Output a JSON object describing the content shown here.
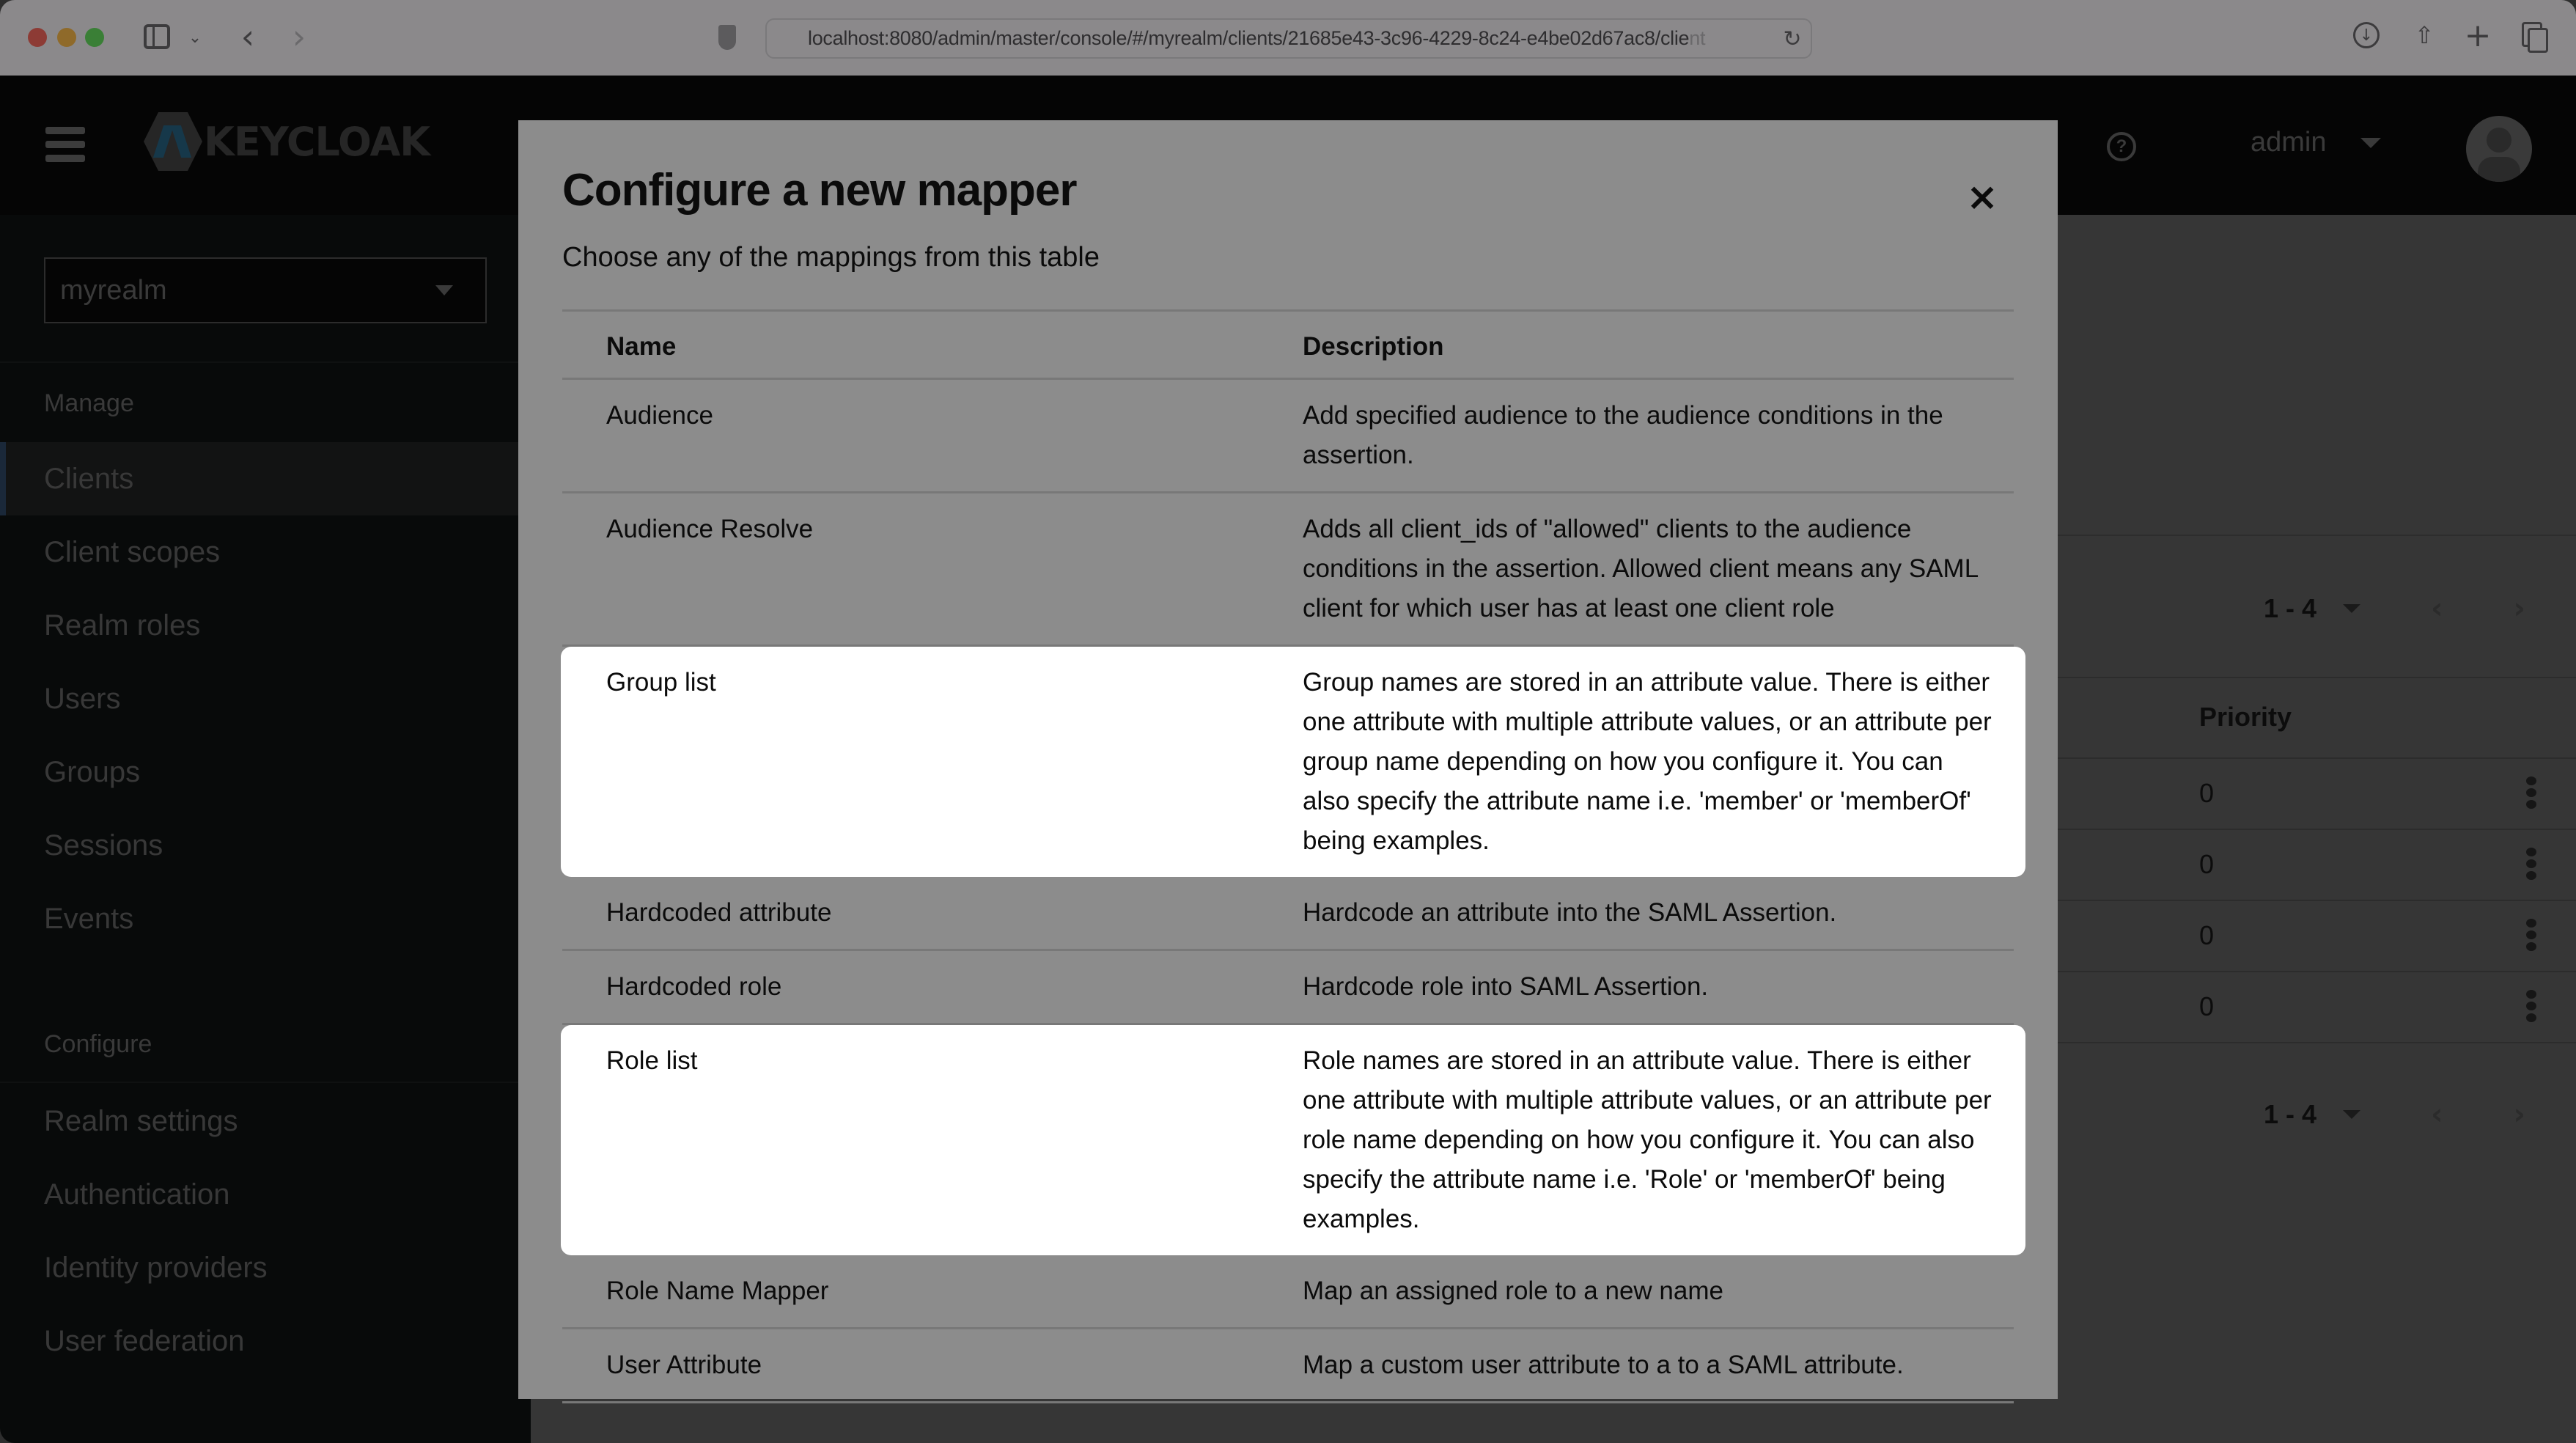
{
  "browser": {
    "url": "localhost:8080/admin/master/console/#/myrealm/clients/21685e43-3c96-4229-8c24-e4be02d67ac8/clie",
    "url_faded_tail": "nt",
    "icons": {
      "sidebar_toggle": "sidebar-icon",
      "back": "chevron-left-icon",
      "forward": "chevron-right-icon",
      "privacy": "shield-icon",
      "reload": "reload-icon",
      "download": "download-icon",
      "share": "share-icon",
      "new_tab": "plus-icon",
      "tab_overview": "tabs-icon"
    },
    "glyphs": {
      "toggle_chevron": "⌄",
      "back": "‹",
      "forward": "›",
      "reload": "↻",
      "download": "↓",
      "share": "⇧",
      "new_tab": "+"
    }
  },
  "masthead": {
    "logo_text": "KEYCLOAK",
    "help_glyph": "?",
    "user_name": "admin"
  },
  "sidebar": {
    "realm": "myrealm",
    "groups": [
      {
        "title": "Manage",
        "items": [
          {
            "label": "Clients",
            "active": true
          },
          {
            "label": "Client scopes"
          },
          {
            "label": "Realm roles"
          },
          {
            "label": "Users"
          },
          {
            "label": "Groups"
          },
          {
            "label": "Sessions"
          },
          {
            "label": "Events"
          }
        ]
      },
      {
        "title": "Configure",
        "items": [
          {
            "label": "Realm settings"
          },
          {
            "label": "Authentication"
          },
          {
            "label": "Identity providers"
          },
          {
            "label": "User federation"
          }
        ]
      }
    ]
  },
  "background_table": {
    "pager_label": "1 - 4",
    "pager_prev": "‹",
    "pager_next": "›",
    "priority_header": "Priority",
    "rows": [
      {
        "priority": "0"
      },
      {
        "priority": "0"
      },
      {
        "priority": "0"
      },
      {
        "priority": "0"
      }
    ]
  },
  "modal": {
    "title": "Configure a new mapper",
    "close_glyph": "×",
    "subtitle": "Choose any of the mappings from this table",
    "columns": {
      "name": "Name",
      "description": "Description"
    },
    "rows": [
      {
        "name": "Audience",
        "description": "Add specified audience to the audience conditions in the assertion.",
        "highlighted": false
      },
      {
        "name": "Audience Resolve",
        "description": "Adds all client_ids of \"allowed\" clients to the audience conditions in the assertion. Allowed client means any SAML client for which user has at least one client role",
        "highlighted": false
      },
      {
        "name": "Group list",
        "description": "Group names are stored in an attribute value. There is either one attribute with multiple attribute values, or an attribute per group name depending on how you configure it. You can also specify the attribute name i.e. 'member' or 'memberOf' being examples.",
        "highlighted": true
      },
      {
        "name": "Hardcoded attribute",
        "description": "Hardcode an attribute into the SAML Assertion.",
        "highlighted": false
      },
      {
        "name": "Hardcoded role",
        "description": "Hardcode role into SAML Assertion.",
        "highlighted": false
      },
      {
        "name": "Role list",
        "description": "Role names are stored in an attribute value. There is either one attribute with multiple attribute values, or an attribute per role name depending on how you configure it. You can also specify the attribute name i.e. 'Role' or 'memberOf' being examples.",
        "highlighted": true
      },
      {
        "name": "Role Name Mapper",
        "description": "Map an assigned role to a new name",
        "highlighted": false
      },
      {
        "name": "User Attribute",
        "description": "Map a custom user attribute to a to a SAML attribute.",
        "highlighted": false
      }
    ]
  }
}
